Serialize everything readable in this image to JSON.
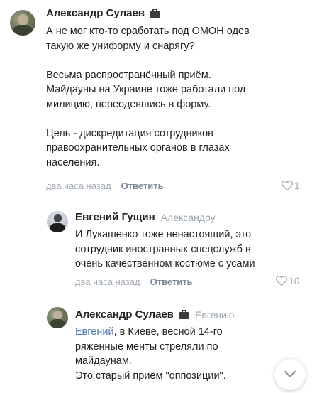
{
  "comments": [
    {
      "author": "Александр Сулаев",
      "lines_a": [
        "А не мог кто-то сработать под ОМОН одев",
        "такую же униформу и снарягу?"
      ],
      "lines_b": [
        "Весьма распространённый приём.",
        "Майдауны на Украине тоже работали под",
        "милицию, переодевшись в форму."
      ],
      "lines_c": [
        "Цель - дискредитация сотрудников",
        "правоохранительных органов в глазах",
        "населения."
      ],
      "time": "два часа назад",
      "reply_label": "Ответить",
      "likes": "1"
    },
    {
      "author": "Евгений Гущин",
      "reply_to": "Александру",
      "lines": [
        "И Лукашенко тоже ненастоящий, это",
        "сотрудник иностранных спецслужб в",
        "очень качественном костюме с усами"
      ],
      "time": "два часа назад",
      "reply_label": "Ответить",
      "likes": "10"
    },
    {
      "author": "Александр Сулаев",
      "reply_to": "Евгению",
      "mention": "Евгений",
      "line1_rest": ", в Киеве, весной 14-го",
      "lines": [
        "ряженные менты стреляли по",
        "майдаунам.",
        "Это старый приём \"оппозиции\"."
      ]
    }
  ],
  "icons": {
    "badge": "briefcase-icon",
    "like": "heart-icon",
    "scroll": "chevron-down-icon"
  },
  "colors": {
    "mention": "#4b7bb5",
    "meta": "#a3abb4",
    "reply_link": "#7a8796"
  }
}
